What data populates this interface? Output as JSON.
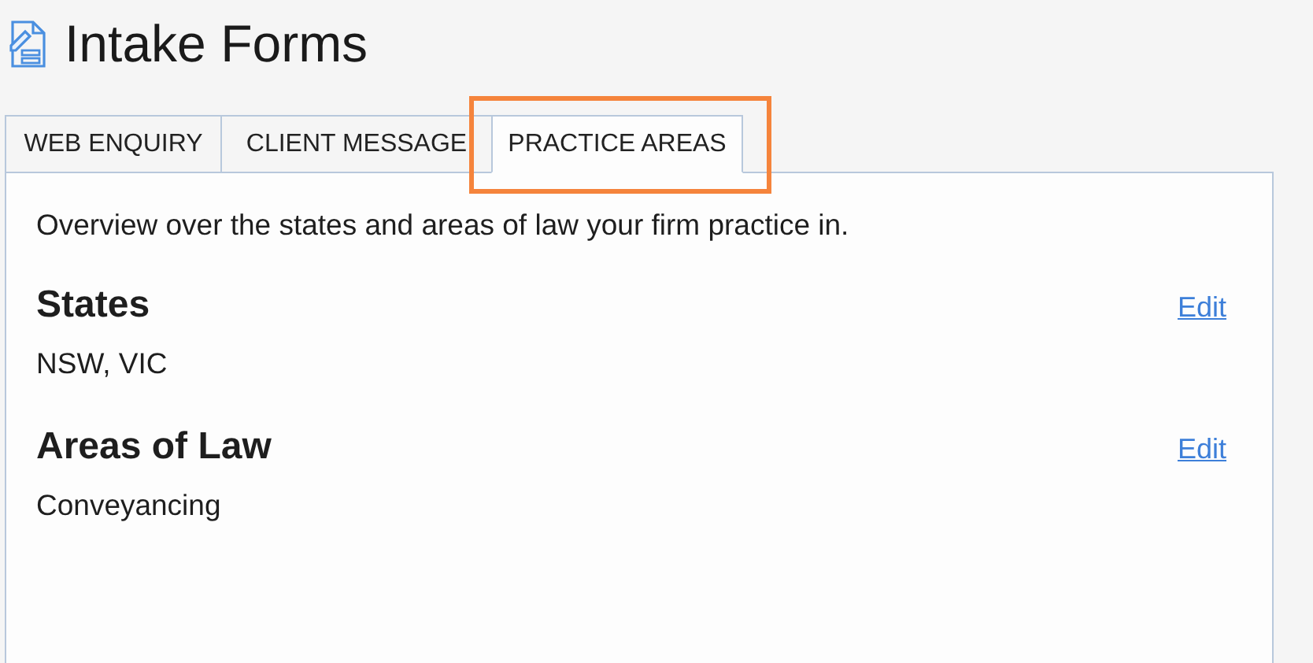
{
  "page": {
    "title": "Intake Forms"
  },
  "tabs": [
    {
      "label": "WEB ENQUIRY",
      "selected": false
    },
    {
      "label": "CLIENT MESSAGE",
      "selected": false
    },
    {
      "label": "PRACTICE AREAS",
      "selected": true
    }
  ],
  "panel": {
    "description": "Overview over the states and areas of law your firm practice in.",
    "sections": [
      {
        "heading": "States",
        "value": "NSW, VIC",
        "action": "Edit"
      },
      {
        "heading": "Areas of Law",
        "value": "Conveyancing",
        "action": "Edit"
      }
    ]
  }
}
